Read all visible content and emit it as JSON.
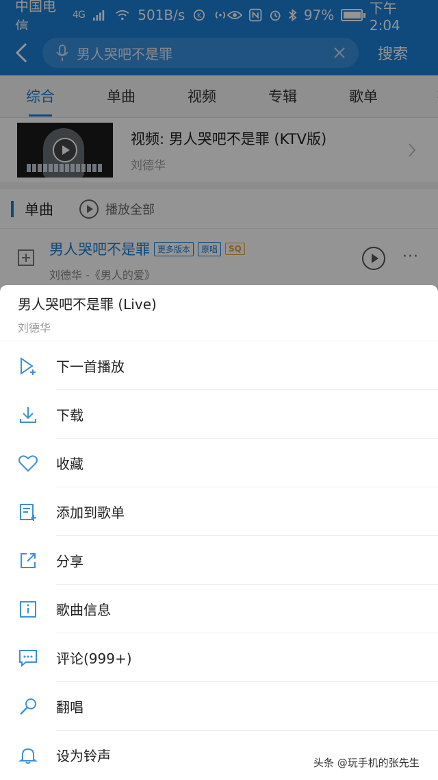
{
  "status_bar": {
    "carrier": "中国电信",
    "network": "4G",
    "speed": "501B/s",
    "battery_percent": "97%",
    "battery_level": 0.97,
    "time": "下午2:04"
  },
  "search": {
    "query": "男人哭吧不是罪",
    "search_button": "搜索"
  },
  "tabs": [
    "综合",
    "单曲",
    "视频",
    "专辑",
    "歌单",
    "有"
  ],
  "video_result": {
    "title": "视频: 男人哭吧不是罪 (KTV版)",
    "artist": "刘德华"
  },
  "songs_section": {
    "title": "单曲",
    "play_all": "播放全部"
  },
  "song": {
    "title": "男人哭吧不是罪",
    "tag_versions": "更多版本",
    "tag_original": "原唱",
    "tag_quality": "SQ",
    "subtitle": "刘德华 -《男人的爱》",
    "more": "···"
  },
  "sheet": {
    "title": "男人哭吧不是罪 (Live)",
    "artist": "刘德华",
    "items": [
      {
        "label": "下一首播放",
        "icon": "play-next-icon"
      },
      {
        "label": "下载",
        "icon": "download-icon"
      },
      {
        "label": "收藏",
        "icon": "heart-icon"
      },
      {
        "label": "添加到歌单",
        "icon": "add-to-playlist-icon"
      },
      {
        "label": "分享",
        "icon": "share-icon"
      },
      {
        "label": "歌曲信息",
        "icon": "info-icon"
      },
      {
        "label": "评论(999+)",
        "icon": "comment-icon"
      },
      {
        "label": "翻唱",
        "icon": "microphone-icon"
      },
      {
        "label": "设为铃声",
        "icon": "bell-icon"
      }
    ]
  },
  "watermark": "头条 @玩手机的张先生",
  "colors": {
    "brand": "#1c7ed6",
    "icon_blue": "#3d8fd6",
    "tag_sq": "#e0a43a"
  }
}
